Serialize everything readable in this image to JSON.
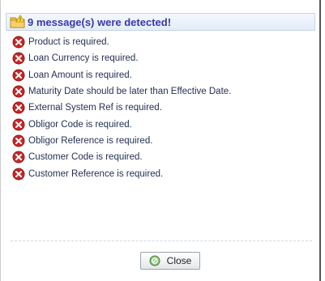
{
  "dialog": {
    "header": {
      "icon": "warning-folder-icon",
      "title": "9 message(s) were detected!"
    },
    "messages": [
      "Product is required.",
      "Loan Currency is required.",
      "Loan Amount is required.",
      "Maturity Date should be later than Effective Date.",
      "External System Ref is required.",
      "Obligor Code is required.",
      "Obligor Reference is required.",
      "Customer Code is required.",
      "Customer Reference is required."
    ],
    "close_button": {
      "icon": "close-circle-icon",
      "label": "Close"
    }
  },
  "colors": {
    "title": "#3a38a8",
    "error_icon": "#c62828",
    "text": "#1f2e4f"
  }
}
